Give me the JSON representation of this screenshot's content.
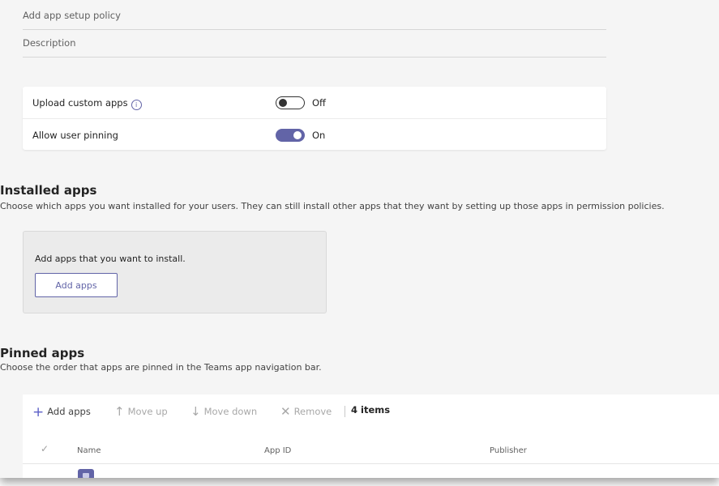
{
  "form": {
    "name_placeholder": "Add app setup policy",
    "description_placeholder": "Description"
  },
  "settings": {
    "upload_custom_apps": {
      "label": "Upload custom apps",
      "state": "Off",
      "on": false,
      "info_icon": "info-icon"
    },
    "allow_user_pinning": {
      "label": "Allow user pinning",
      "state": "On",
      "on": true
    }
  },
  "installed_apps": {
    "title": "Installed apps",
    "description": "Choose which apps you want installed for your users. They can still install other apps that they want by setting up those apps in permission policies.",
    "prompt": "Add apps that you want to install.",
    "add_button": "Add apps"
  },
  "pinned_apps": {
    "title": "Pinned apps",
    "description": "Choose the order that apps are pinned in the Teams app navigation bar.",
    "toolbar": {
      "add": "Add apps",
      "move_up": "Move up",
      "move_down": "Move down",
      "remove": "Remove",
      "count": "4 items"
    },
    "columns": [
      "Name",
      "App ID",
      "Publisher"
    ]
  },
  "colors": {
    "accent": "#6264a7",
    "background": "#f5f5f5"
  }
}
